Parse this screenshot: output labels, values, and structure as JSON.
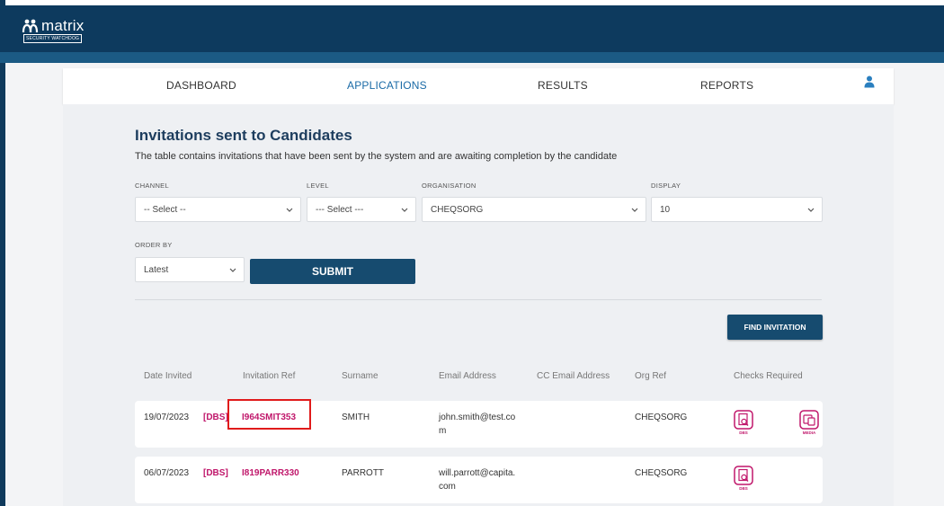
{
  "app": {
    "logo_text": "matrix",
    "logo_sub": "SECURITY WATCHDOG"
  },
  "nav": {
    "items": [
      "DASHBOARD",
      "APPLICATIONS",
      "RESULTS",
      "REPORTS"
    ],
    "active": "APPLICATIONS"
  },
  "page": {
    "title": "Invitations sent to Candidates",
    "subtitle": "The table contains invitations that have been sent by the system and are awaiting completion by the candidate"
  },
  "filters": {
    "channel": {
      "label": "CHANNEL",
      "value": "-- Select --"
    },
    "level": {
      "label": "LEVEL",
      "value": "--- Select ---"
    },
    "organisation": {
      "label": "ORGANISATION",
      "value": "CHEQSORG"
    },
    "display": {
      "label": "DISPLAY",
      "value": "10"
    },
    "order_by": {
      "label": "ORDER BY",
      "value": "Latest"
    },
    "submit_label": "SUBMIT"
  },
  "find_invitation_label": "FIND INVITATION",
  "table": {
    "headers": [
      "Date Invited",
      "Invitation Ref",
      "Surname",
      "Email Address",
      "CC Email Address",
      "Org Ref",
      "Checks Required"
    ],
    "rows": [
      {
        "date": "19/07/2023",
        "tag": "[DBS]",
        "ref": "I964SMIT353",
        "surname": "SMITH",
        "email_l1": "john.smith@test.co",
        "email_l2": "m",
        "cc": "",
        "org": "CHEQSORG",
        "checks": [
          "DBS",
          "MEDIA"
        ]
      },
      {
        "date": "06/07/2023",
        "tag": "[DBS]",
        "ref": "I819PARR330",
        "surname": "PARROTT",
        "email_l1": "will.parrott@capita.",
        "email_l2": "com",
        "cc": "",
        "org": "CHEQSORG",
        "checks": [
          "DBS"
        ]
      }
    ]
  },
  "colors": {
    "header": "#0d3a5e",
    "accent": "#1a6aa6",
    "button": "#164b6f",
    "ref": "#c0176b",
    "highlight": "#e01b1b"
  },
  "icons": {
    "logo": "people-icon",
    "user": "user-icon",
    "dbs": "document-search-icon",
    "media": "media-icon"
  }
}
